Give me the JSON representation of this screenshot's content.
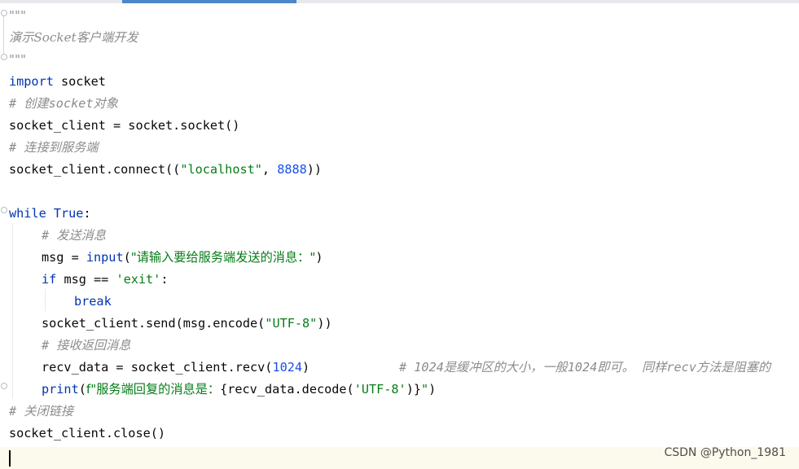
{
  "editor": {
    "lines": {
      "l1": "\"\"\"",
      "l2": "演示Socket客户端开发",
      "l3": "\"\"\"",
      "l4_kw": "import",
      "l4_rest": " socket",
      "l5": "# 创建socket对象",
      "l6": "socket_client = socket.socket()",
      "l7": "# 连接到服务端",
      "l8_a": "socket_client.connect((",
      "l8_str": "\"localhost\"",
      "l8_b": ", ",
      "l8_num": "8888",
      "l8_c": "))",
      "l10_kw1": "while",
      "l10_sp": " ",
      "l10_kw2": "True",
      "l10_colon": ":",
      "l11": "# 发送消息",
      "l12_a": "msg = ",
      "l12_fn": "input",
      "l12_b": "(",
      "l12_str": "\"请输入要给服务端发送的消息：\"",
      "l12_c": ")",
      "l13_kw": "if",
      "l13_a": " msg == ",
      "l13_str": "'exit'",
      "l13_b": ":",
      "l14_kw": "break",
      "l15_a": "socket_client.send(msg.encode(",
      "l15_str": "\"UTF-8\"",
      "l15_b": "))",
      "l16": "# 接收返回消息",
      "l17_a": "recv_data = socket_client.recv(",
      "l17_num": "1024",
      "l17_b": ")",
      "l17_cmt": "# 1024是缓冲区的大小，一般1024即可。 同样recv方法是阻塞的",
      "l18_fn": "print",
      "l18_a": "(",
      "l18_str1": "f\"服务端回复的消息是：",
      "l18_b": "{recv_data.decode(",
      "l18_str2": "'UTF-8'",
      "l18_c": ")}",
      "l18_str3": "\"",
      "l18_d": ")",
      "l19": "# 关闭链接",
      "l20": "socket_client.close()"
    }
  },
  "watermark": "CSDN @Python_1981",
  "colors": {
    "keyword": "#0033b3",
    "string": "#067d17",
    "number": "#1750eb",
    "comment": "#8c8c8c",
    "current_line": "#fcfaed",
    "active_tab": "#4a88c7"
  }
}
